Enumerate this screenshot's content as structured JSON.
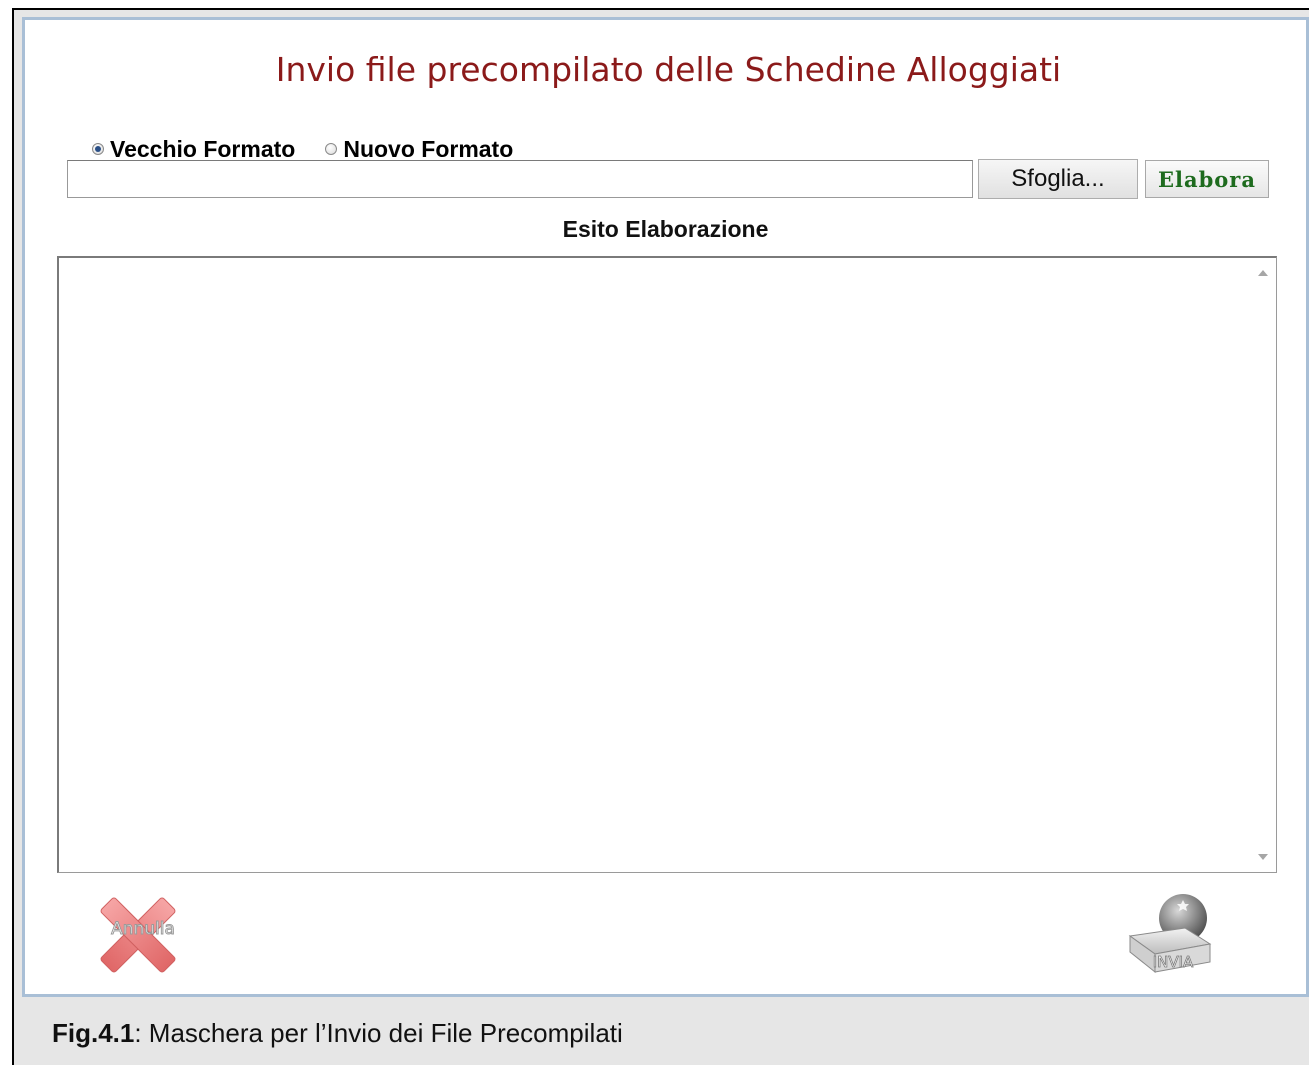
{
  "window": {
    "title": "Invio file precompilato delle Schedine Alloggiati"
  },
  "format_options": [
    {
      "label": "Vecchio Formato",
      "selected": true
    },
    {
      "label": "Nuovo Formato",
      "selected": false
    }
  ],
  "file_input": {
    "value": "",
    "placeholder": ""
  },
  "buttons": {
    "browse_label": "Sfoglia...",
    "process_label": "Elabora",
    "cancel_label": "Annulla",
    "send_label": "INVIA"
  },
  "output": {
    "heading": "Esito Elaborazione",
    "text": ""
  },
  "caption": {
    "figure_label": "Fig.4.1",
    "text": ": Maschera per l’Invio dei File Precompilati"
  },
  "colors": {
    "title": "#8b1a1a",
    "process_button_text": "#1e6b1e",
    "window_border": "#a9bfd6",
    "cancel_icon": "#e8797a"
  }
}
